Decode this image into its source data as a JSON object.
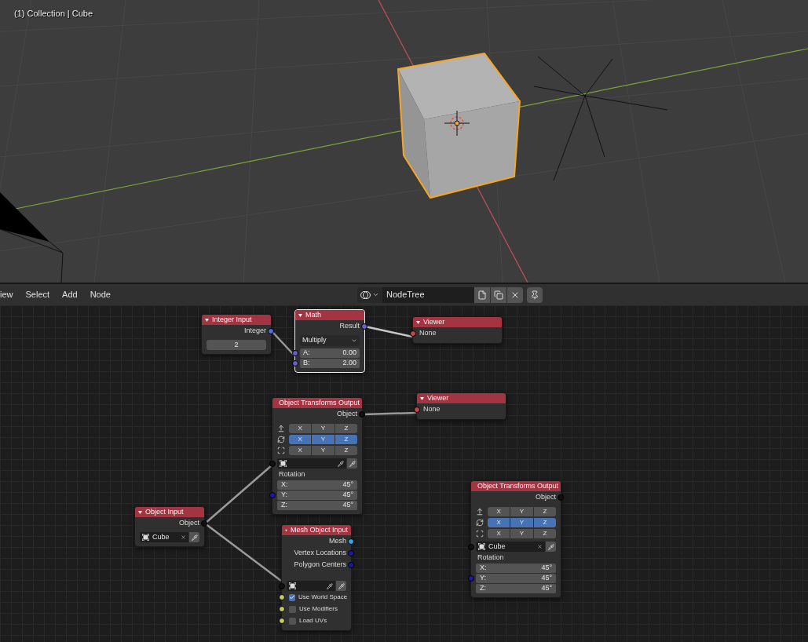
{
  "viewport": {
    "info": "(1) Collection | Cube"
  },
  "node_editor": {
    "menu": [
      {
        "label": "iew"
      },
      {
        "label": "Select"
      },
      {
        "label": "Add"
      },
      {
        "label": "Node"
      }
    ],
    "tree_name": "NodeTree",
    "nodes": [
      {
        "title": "Integer Input",
        "selected": false,
        "rows": [
          {
            "kind": "output",
            "label": "Integer",
            "color": "#5a6bd8"
          },
          {
            "kind": "number",
            "value": "2"
          }
        ]
      },
      {
        "title": "Math",
        "selected": true,
        "rows": [
          {
            "kind": "output",
            "label": "Result",
            "color": "#6363c7"
          },
          {
            "kind": "dropdown",
            "value": "Multiply"
          },
          {
            "kind": "input_field",
            "label": "A:",
            "value": "0.00",
            "color": "#6363c7"
          },
          {
            "kind": "input_field",
            "label": "B:",
            "value": "2.00",
            "color": "#6363c7"
          }
        ]
      },
      {
        "title": "Viewer",
        "selected": false,
        "rows": [
          {
            "kind": "input_label",
            "label": "None",
            "color": "#c04848"
          }
        ]
      },
      {
        "title": "Object Transforms Output",
        "selected": false,
        "rows": [
          {
            "kind": "output",
            "label": "Object",
            "color": "#111111"
          },
          {
            "kind": "transforms",
            "groups": [
              {
                "buttons": [
                  {
                    "label": "X",
                    "selected": false
                  },
                  {
                    "label": "Y",
                    "selected": false
                  },
                  {
                    "label": "Z",
                    "selected": false
                  }
                ]
              },
              {
                "buttons": [
                  {
                    "label": "X",
                    "selected": true
                  },
                  {
                    "label": "Y",
                    "selected": true
                  },
                  {
                    "label": "Z",
                    "selected": true
                  }
                ]
              },
              {
                "buttons": [
                  {
                    "label": "X",
                    "selected": false
                  },
                  {
                    "label": "Y",
                    "selected": false
                  },
                  {
                    "label": "Z",
                    "selected": false
                  }
                ]
              }
            ]
          },
          {
            "kind": "object",
            "color": "#111111"
          },
          {
            "kind": "label",
            "label": "Rotation"
          },
          {
            "kind": "vector",
            "color": "#1d1aa0",
            "fields": [
              {
                "label": "X:",
                "value": "45°"
              },
              {
                "label": "Y:",
                "value": "45°"
              },
              {
                "label": "Z:",
                "value": "45°"
              }
            ]
          }
        ]
      },
      {
        "title": "Viewer",
        "selected": false,
        "rows": [
          {
            "kind": "input_label",
            "label": "None",
            "color": "#c04848"
          }
        ]
      },
      {
        "title": "Object Input",
        "selected": false,
        "rows": [
          {
            "kind": "output",
            "label": "Object",
            "color": "#111111"
          },
          {
            "kind": "object",
            "value": "Cube"
          }
        ]
      },
      {
        "title": "Mesh Object Input",
        "selected": false,
        "rows": [
          {
            "kind": "output",
            "label": "Mesh",
            "color": "#2fa8f0"
          },
          {
            "kind": "output",
            "label": "Vertex Locations",
            "color": "#1d1aa0"
          },
          {
            "kind": "output",
            "label": "Polygon Centers",
            "color": "#1d1aa0"
          },
          {
            "kind": "object",
            "color": "#111111"
          },
          {
            "kind": "checkbox",
            "label": "Use World Space",
            "checked": true,
            "color": "#c8c864"
          },
          {
            "kind": "checkbox",
            "label": "Use Modifiers",
            "checked": false,
            "color": "#c8c864"
          },
          {
            "kind": "checkbox",
            "label": "Load UVs",
            "checked": false,
            "color": "#c8c864"
          }
        ]
      },
      {
        "title": "Object Transforms Output",
        "selected": false,
        "rows": [
          {
            "kind": "output",
            "label": "Object",
            "color": "#111111"
          },
          {
            "kind": "transforms",
            "groups": [
              {
                "buttons": [
                  {
                    "label": "X",
                    "selected": false
                  },
                  {
                    "label": "Y",
                    "selected": false
                  },
                  {
                    "label": "Z",
                    "selected": false
                  }
                ]
              },
              {
                "buttons": [
                  {
                    "label": "X",
                    "selected": true
                  },
                  {
                    "label": "Y",
                    "selected": true
                  },
                  {
                    "label": "Z",
                    "selected": true
                  }
                ]
              },
              {
                "buttons": [
                  {
                    "label": "X",
                    "selected": false
                  },
                  {
                    "label": "Y",
                    "selected": false
                  },
                  {
                    "label": "Z",
                    "selected": false
                  }
                ]
              }
            ]
          },
          {
            "kind": "object",
            "value": "Cube",
            "color": "#111111"
          },
          {
            "kind": "label",
            "label": "Rotation"
          },
          {
            "kind": "vector",
            "color": "#1d1aa0",
            "fields": [
              {
                "label": "X:",
                "value": "45°"
              },
              {
                "label": "Y:",
                "value": "45°"
              },
              {
                "label": "Z:",
                "value": "45°"
              }
            ]
          }
        ]
      }
    ]
  }
}
